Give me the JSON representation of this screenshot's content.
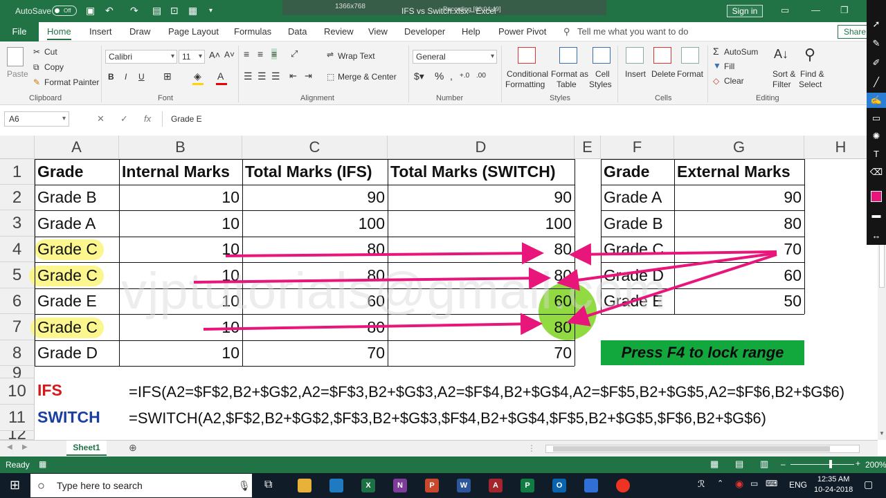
{
  "titlebar": {
    "autosave": "AutoSave",
    "toggle": "Off",
    "title": "IFS vs Switch.xlsx - Excel",
    "signin": "Sign in",
    "rec_dims": "1366x768",
    "rec_timer": "Recording [00:04:49]"
  },
  "tabs": {
    "file": "File",
    "items": [
      "Home",
      "Insert",
      "Draw",
      "Page Layout",
      "Formulas",
      "Data",
      "Review",
      "View",
      "Developer",
      "Help",
      "Power Pivot"
    ],
    "tell": "Tell me what you want to do",
    "share": "Share"
  },
  "ribbon": {
    "clipboard": {
      "label": "Clipboard",
      "paste": "Paste",
      "cut": "Cut",
      "copy": "Copy",
      "format_painter": "Format Painter"
    },
    "font": {
      "label": "Font",
      "name": "Calibri",
      "size": "11"
    },
    "alignment": {
      "label": "Alignment",
      "wrap": "Wrap Text",
      "merge": "Merge & Center"
    },
    "number": {
      "label": "Number",
      "format": "General"
    },
    "styles": {
      "label": "Styles",
      "cond1": "Conditional",
      "cond2": "Formatting",
      "fmt1": "Format as",
      "fmt2": "Table",
      "cell1": "Cell",
      "cell2": "Styles"
    },
    "cells": {
      "label": "Cells",
      "insert": "Insert",
      "delete": "Delete",
      "format": "Format"
    },
    "editing": {
      "label": "Editing",
      "autosum": "AutoSum",
      "fill": "Fill",
      "clear": "Clear",
      "sort1": "Sort &",
      "sort2": "Filter",
      "find1": "Find &",
      "find2": "Select"
    }
  },
  "formula_bar": {
    "name_box": "A6",
    "fx": "fx",
    "content": "Grade E"
  },
  "columns": [
    "A",
    "B",
    "C",
    "D",
    "E",
    "F",
    "G",
    "H"
  ],
  "rows": [
    "1",
    "2",
    "3",
    "4",
    "5",
    "6",
    "7",
    "8",
    "9",
    "10",
    "11",
    "12"
  ],
  "table1": {
    "headers": [
      "Grade",
      "Internal Marks",
      "Total Marks (IFS)",
      "Total Marks (SWITCH)"
    ],
    "rows": [
      [
        "Grade B",
        "10",
        "90",
        "90"
      ],
      [
        "Grade A",
        "10",
        "100",
        "100"
      ],
      [
        "Grade C",
        "10",
        "80",
        "80"
      ],
      [
        "Grade C",
        "10",
        "80",
        "80"
      ],
      [
        "Grade E",
        "10",
        "60",
        "60"
      ],
      [
        "Grade C",
        "10",
        "80",
        "80"
      ],
      [
        "Grade D",
        "10",
        "70",
        "70"
      ]
    ]
  },
  "table2": {
    "headers": [
      "Grade",
      "External Marks"
    ],
    "rows": [
      [
        "Grade A",
        "90"
      ],
      [
        "Grade B",
        "80"
      ],
      [
        "Grade C",
        "70"
      ],
      [
        "Grade D",
        "60"
      ],
      [
        "Grade E",
        "50"
      ]
    ]
  },
  "note": "Press F4 to lock range",
  "row10": {
    "label": "IFS",
    "formula": "=IFS(A2=$F$2,B2+$G$2,A2=$F$3,B2+$G$3,A2=$F$4,B2+$G$4,A2=$F$5,B2+$G$5,A2=$F$6,B2+$G$6)"
  },
  "row11": {
    "label": "SWITCH",
    "formula": "=SWITCH(A2,$F$2,B2+$G$2,$F$3,B2+$G$3,$F$4,B2+$G$4,$F$5,B2+$G$5,$F$6,B2+$G$6)"
  },
  "watermark": "vjptutorials@gmail.com",
  "sheet": {
    "tab": "Sheet1"
  },
  "status": {
    "ready": "Ready",
    "zoom": "200%"
  },
  "taskbar": {
    "search_placeholder": "Type here to search",
    "lang": "ENG",
    "time": "12:35 AM",
    "date": "10-24-2018"
  },
  "colors": {
    "excel_green": "#217346",
    "arrow": "#e8157a",
    "highlight": "#fbf57a",
    "cursor_ring": "#7ed321",
    "note_bg": "#13a83d",
    "ifs_label": "#d31a1a",
    "switch_label": "#1a3fa0"
  }
}
